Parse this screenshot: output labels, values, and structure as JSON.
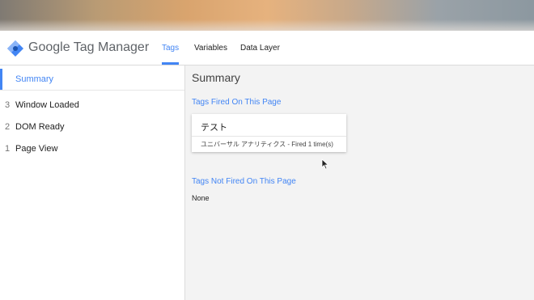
{
  "app": {
    "product_name": "Google Tag Manager"
  },
  "tabs": [
    {
      "label": "Tags",
      "active": true
    },
    {
      "label": "Variables",
      "active": false
    },
    {
      "label": "Data Layer",
      "active": false
    }
  ],
  "sidebar": {
    "summary_label": "Summary",
    "events": [
      {
        "number": "3",
        "label": "Window Loaded"
      },
      {
        "number": "2",
        "label": "DOM Ready"
      },
      {
        "number": "1",
        "label": "Page View"
      }
    ]
  },
  "main": {
    "title": "Summary",
    "fired_heading": "Tags Fired On This Page",
    "fired_tags": [
      {
        "name": "テスト",
        "detail": "ユニバーサル アナリティクス - Fired 1 time(s)"
      }
    ],
    "not_fired_heading": "Tags Not Fired On This Page",
    "not_fired_text": "None"
  },
  "colors": {
    "accent": "#4285f4",
    "logo_diamond": "#4285f4",
    "logo_dark": "#1a53b0"
  },
  "icons": {
    "logo": "gtm-diamond-icon",
    "cursor": "mouse-pointer-icon"
  }
}
